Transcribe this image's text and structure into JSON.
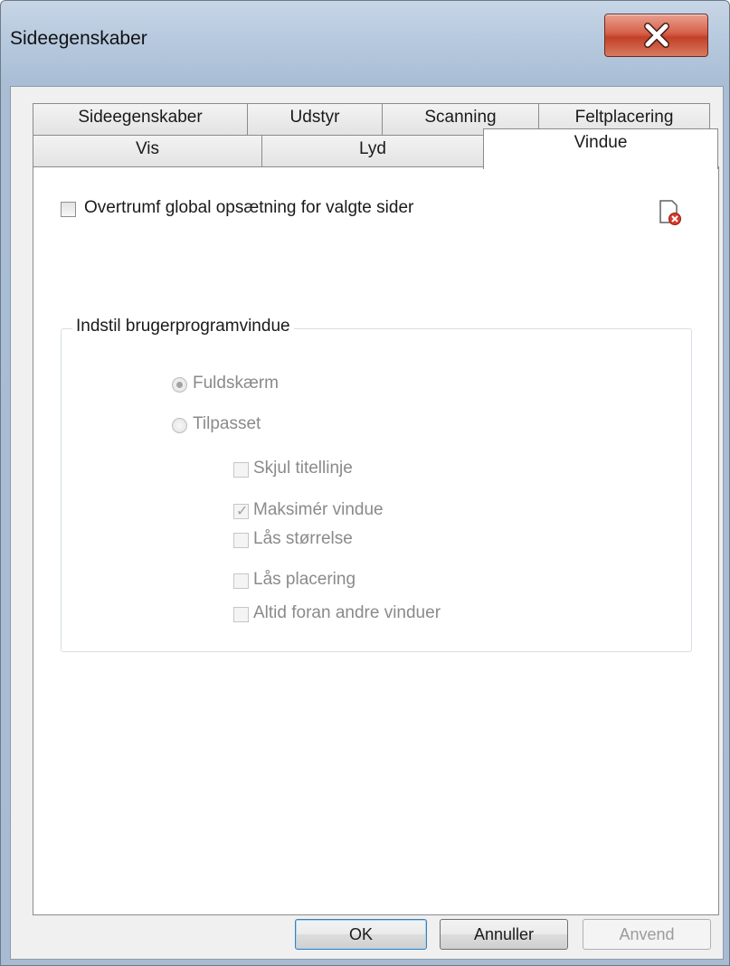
{
  "window": {
    "title": "Sideegenskaber"
  },
  "tabs": {
    "row1": [
      {
        "label": "Sideegenskaber"
      },
      {
        "label": "Udstyr"
      },
      {
        "label": "Scanning"
      },
      {
        "label": "Feltplacering"
      }
    ],
    "row2": [
      {
        "label": "Vis"
      },
      {
        "label": "Lyd"
      },
      {
        "label": "Vindue",
        "active": true
      }
    ]
  },
  "panel": {
    "override_checkbox": {
      "label": "Overtrumf global opsætning for valgte sider",
      "checked": false
    },
    "group": {
      "legend": "Indstil brugerprogramvindue",
      "radios": [
        {
          "label": "Fuldskærm",
          "selected": true,
          "enabled": false
        },
        {
          "label": "Tilpasset",
          "selected": false,
          "enabled": false
        }
      ],
      "checkboxes": [
        {
          "label": "Skjul titellinje",
          "checked": false,
          "enabled": false
        },
        {
          "label": "Maksimér vindue",
          "checked": true,
          "enabled": false
        },
        {
          "label": "Lås størrelse",
          "checked": false,
          "enabled": false
        },
        {
          "label": "Lås placering",
          "checked": false,
          "enabled": false
        },
        {
          "label": "Altid foran andre vinduer",
          "checked": false,
          "enabled": false
        }
      ]
    },
    "reset_icon": "document-delete-icon"
  },
  "buttons": {
    "ok": "OK",
    "cancel": "Annuller",
    "apply": "Anvend"
  },
  "colors": {
    "close_button": "#c8452f",
    "disabled_text": "#8a8a8a"
  }
}
